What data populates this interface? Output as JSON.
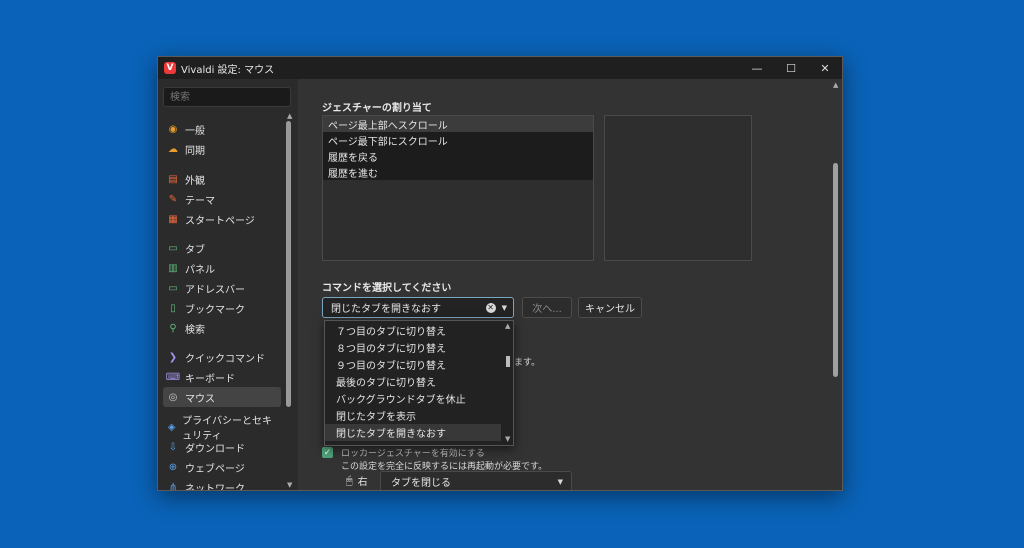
{
  "window": {
    "title": "Vivaldi 設定: マウス",
    "logo_letter": "V",
    "controls": {
      "minimize": "—",
      "maximize": "☐",
      "close": "✕"
    }
  },
  "sidebar": {
    "search_placeholder": "検索",
    "items": [
      {
        "label": "一般",
        "icon": "general-icon",
        "color": "#e89d2b"
      },
      {
        "label": "同期",
        "icon": "cloud-icon",
        "color": "#e89d2b"
      },
      {
        "label": "外観",
        "icon": "appearance-icon",
        "color": "#ef6a3a"
      },
      {
        "label": "テーマ",
        "icon": "theme-brush-icon",
        "color": "#ef6a3a"
      },
      {
        "label": "スタートページ",
        "icon": "start-page-icon",
        "color": "#ef6a3a"
      },
      {
        "label": "タブ",
        "icon": "tab-icon",
        "color": "#5fbd7a"
      },
      {
        "label": "パネル",
        "icon": "panel-icon",
        "color": "#5fbd7a"
      },
      {
        "label": "アドレスバー",
        "icon": "address-bar-icon",
        "color": "#5fbd7a"
      },
      {
        "label": "ブックマーク",
        "icon": "bookmark-icon",
        "color": "#5fbd7a"
      },
      {
        "label": "検索",
        "icon": "search-icon",
        "color": "#5fbd7a"
      },
      {
        "label": "クイックコマンド",
        "icon": "quick-command-icon",
        "color": "#a392e8"
      },
      {
        "label": "キーボード",
        "icon": "keyboard-icon",
        "color": "#a392e8"
      },
      {
        "label": "マウス",
        "icon": "mouse-icon",
        "color": "#cfcfcf"
      },
      {
        "label": "プライバシーとセキュリティ",
        "icon": "shield-icon",
        "color": "#5aa2e8"
      },
      {
        "label": "ダウンロード",
        "icon": "download-icon",
        "color": "#5aa2e8"
      },
      {
        "label": "ウェブページ",
        "icon": "globe-icon",
        "color": "#5aa2e8"
      },
      {
        "label": "ネットワーク",
        "icon": "network-icon",
        "color": "#5aa2e8"
      }
    ],
    "active_index": 12
  },
  "main": {
    "gesture_heading": "ジェスチャーの割り当て",
    "gestures": [
      "ページ最上部へスクロール",
      "ページ最下部にスクロール",
      "履歴を戻る",
      "履歴を進む"
    ],
    "selected_gesture_index": 0,
    "command_heading": "コマンドを選択してください",
    "command_value": "閉じたタブを開きなおす",
    "next_button": "次へ...",
    "cancel_button": "キャンセル",
    "partial_note": "ます。",
    "rocker_label_partial": "ロッカージェスチャーを有効にする",
    "restart_note": "この設定を完全に反映するには再起動が必要です。",
    "mouse_button_label": "右",
    "mouse_action": "タブを閉じる"
  },
  "dropdown": {
    "options": [
      "７つ目のタブに切り替え",
      "８つ目のタブに切り替え",
      "９つ目のタブに切り替え",
      "最後のタブに切り替え",
      "バックグラウンドタブを休止",
      "閉じたタブを表示",
      "閉じたタブを開きなおす"
    ],
    "highlighted_index": 6
  }
}
